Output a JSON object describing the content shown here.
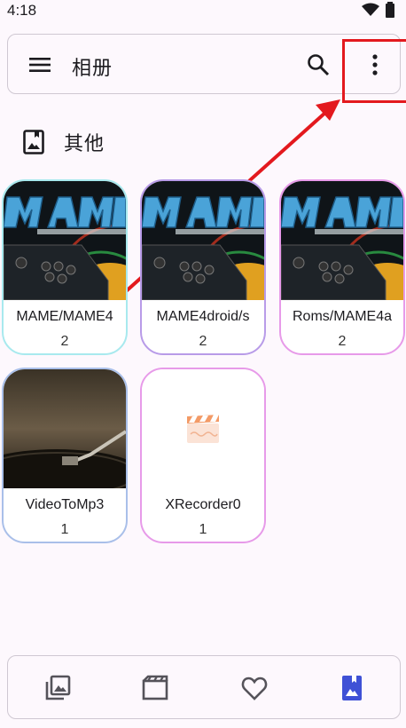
{
  "status": {
    "time": "4:18"
  },
  "toolbar": {
    "title": "相册"
  },
  "section": {
    "title": "其他"
  },
  "albums": [
    {
      "name": "MAME/MAME4",
      "count": "2",
      "border": "#a8e9ee",
      "thumb": "mame-logo"
    },
    {
      "name": "MAME4droid/s",
      "count": "2",
      "border": "#b89be8",
      "thumb": "mame-logo"
    },
    {
      "name": "Roms/MAME4a",
      "count": "2",
      "border": "#e79ae9",
      "thumb": "mame-logo"
    },
    {
      "name": "VideoToMp3",
      "count": "1",
      "border": "#a9bfe9",
      "thumb": "turntable-photo"
    },
    {
      "name": "XRecorder0",
      "count": "1",
      "border": "#e79ae9",
      "thumb": "clapperboard-icon"
    }
  ],
  "bottom_nav": {
    "items": [
      "photos-icon",
      "videos-icon",
      "favorites-icon",
      "albums-icon"
    ],
    "active": "albums-icon",
    "active_color": "#3f51d6"
  }
}
